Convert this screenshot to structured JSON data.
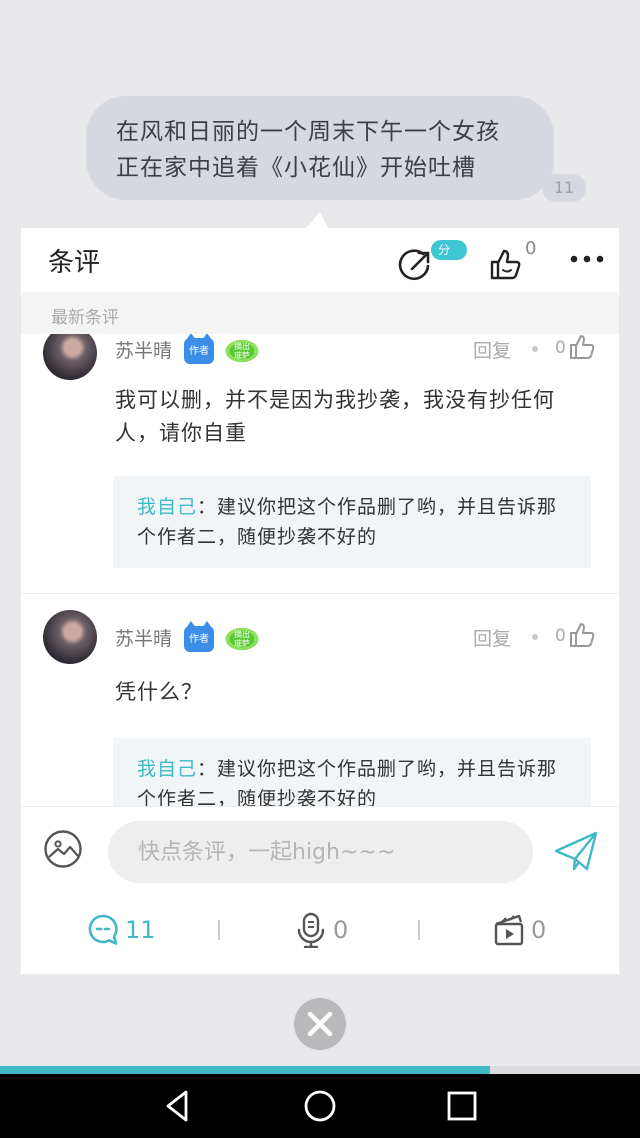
{
  "quote": {
    "lines": [
      "在风和日丽的一个周末下午一个女孩",
      "正在家中追着《小花仙》开始吐槽"
    ],
    "count": "11"
  },
  "header": {
    "title": "条评",
    "share_badge": "分享",
    "like_count": "0"
  },
  "section": {
    "label": "最新条评"
  },
  "comments": [
    {
      "username": "苏半晴",
      "author_badge": "作者",
      "level_badge": "摘出\n璀萨",
      "reply_label": "回复",
      "like_count": "0",
      "text": "我可以删，并不是因为我抄袭，我没有抄任何人，请你自重",
      "reply": {
        "name": "我自己",
        "text": "：建议你把这个作品删了哟，并且告诉那个作者二，随便抄袭不好的"
      }
    },
    {
      "username": "苏半晴",
      "author_badge": "作者",
      "level_badge": "摘出\n璀萨",
      "reply_label": "回复",
      "like_count": "0",
      "text": "凭什么？",
      "reply": {
        "name": "我自己",
        "text": "：建议你把这个作品删了哟，并且告诉那个作者二，随便抄袭不好的"
      }
    }
  ],
  "input": {
    "placeholder": "快点条评，一起high~~~"
  },
  "stats": {
    "comments": "11",
    "voice": "0",
    "video": "0"
  },
  "progress": {
    "fraction": 0.765
  },
  "colors": {
    "accent": "#3fb8c8",
    "author_badge": "#3b8ee8",
    "level_badge": "#58c935"
  },
  "icons": {
    "header": [
      "share-icon",
      "thumbs-up-icon",
      "more-icon"
    ],
    "input": [
      "image-icon",
      "send-icon"
    ],
    "stats": [
      "chat-bubble-icon",
      "microphone-icon",
      "clapperboard-icon"
    ],
    "nav": [
      "back-icon",
      "home-icon",
      "recents-icon"
    ]
  }
}
